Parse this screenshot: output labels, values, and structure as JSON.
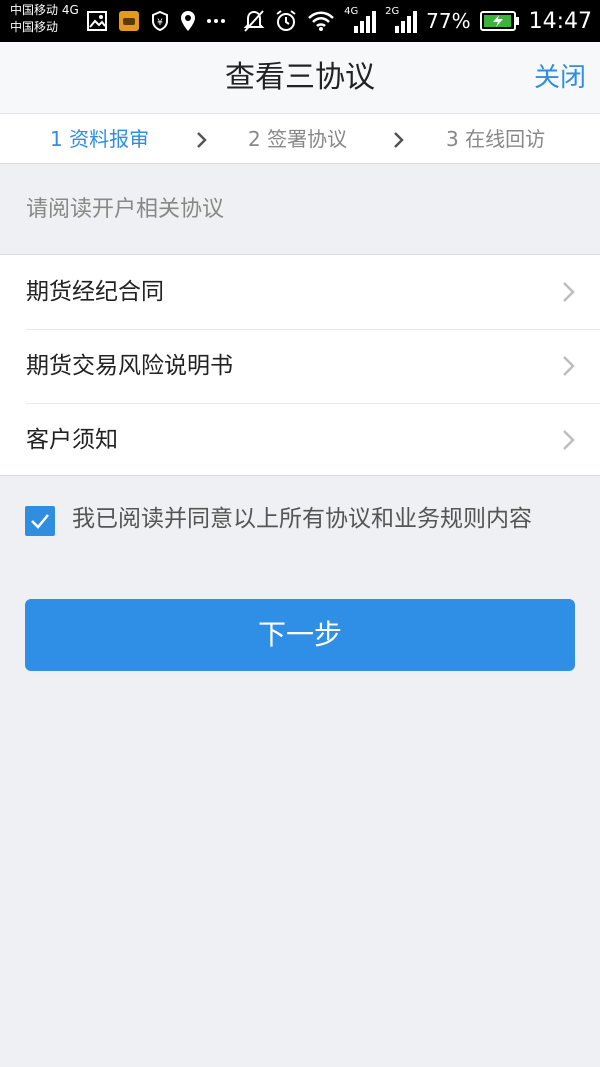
{
  "status_bar": {
    "carrier_1": "中国移动 4G",
    "carrier_2": "中国移动",
    "net_4g": "4G",
    "net_2g": "2G",
    "battery": "77%",
    "time": "14:47"
  },
  "navbar": {
    "title": "查看三协议",
    "close_label": "关闭"
  },
  "steps": [
    {
      "label": "1 资料报审",
      "active": true
    },
    {
      "label": "2 签署协议",
      "active": false
    },
    {
      "label": "3 在线回访",
      "active": false
    }
  ],
  "section_hint": "请阅读开户相关协议",
  "agreements": [
    {
      "label": "期货经纪合同"
    },
    {
      "label": "期货交易风险说明书"
    },
    {
      "label": "客户须知"
    }
  ],
  "agree": {
    "checked": true,
    "text": "我已阅读并同意以上所有协议和业务规则内容"
  },
  "next_button": "下一步",
  "colors": {
    "accent": "#2f8ee0",
    "background": "#eff0f4"
  }
}
